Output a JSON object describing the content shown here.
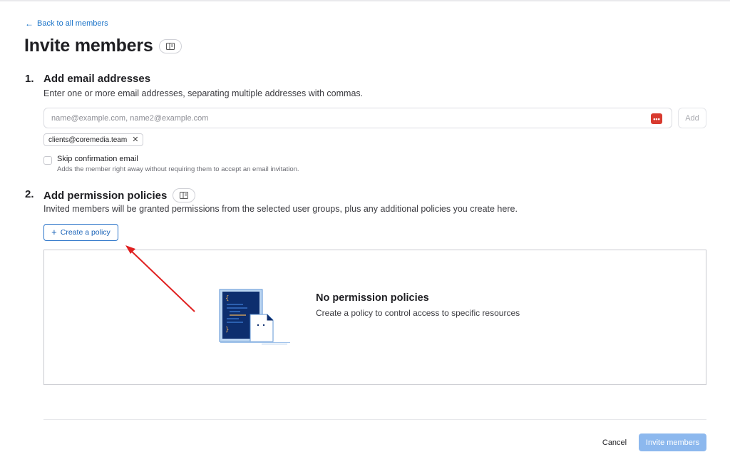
{
  "nav": {
    "back_label": "Back to all members"
  },
  "page": {
    "title": "Invite members"
  },
  "step1": {
    "number": "1.",
    "title": "Add email addresses",
    "description": "Enter one or more email addresses, separating multiple addresses with commas.",
    "input_placeholder": "name@example.com, name2@example.com",
    "input_value": "",
    "password_badge": "•••",
    "add_label": "Add",
    "tags": [
      "clients@coremedia.team"
    ],
    "skip_label": "Skip confirmation email",
    "skip_help": "Adds the member right away without requiring them to accept an email invitation.",
    "skip_checked": false
  },
  "step2": {
    "number": "2.",
    "title": "Add permission policies",
    "description": "Invited members will be granted permissions from the selected user groups, plus any additional policies you create here.",
    "create_label": "Create a policy",
    "empty_title": "No permission policies",
    "empty_description": "Create a policy to control access to specific resources"
  },
  "footer": {
    "cancel_label": "Cancel",
    "invite_label": "Invite members"
  },
  "colors": {
    "accent": "#1a73c8",
    "invite_disabled": "#8cb8ee",
    "annotation_arrow": "#e02020",
    "password_badge": "#d83a2f"
  }
}
